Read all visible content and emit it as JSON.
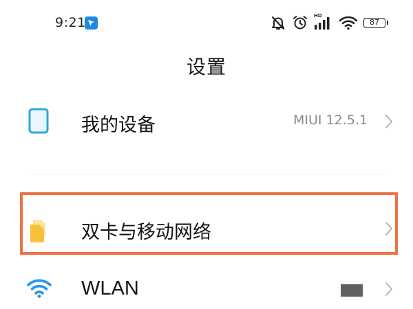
{
  "status_bar": {
    "time": "9:21",
    "hd_label": "HD",
    "battery_level": "87",
    "icons": [
      "app-notification-icon",
      "mute-icon",
      "alarm-icon",
      "signal-icon",
      "wifi-icon",
      "battery-icon"
    ]
  },
  "header": {
    "title": "设置"
  },
  "settings_items": [
    {
      "label": "我的设备",
      "value": "MIUI 12.5.1",
      "icon": "phone-device-icon",
      "icon_color": "#29a8e0"
    },
    {
      "label": "双卡与移动网络",
      "value": "",
      "icon": "sim-cards-icon",
      "icon_color": "#f6c23c",
      "highlighted": true
    },
    {
      "label": "WLAN",
      "value": "",
      "icon": "wifi-icon",
      "icon_color": "#2196f3"
    }
  ],
  "colors": {
    "highlight_border": "#ee7148",
    "chevron": "#b5b5b5",
    "secondary_text": "#8a8a8a"
  }
}
